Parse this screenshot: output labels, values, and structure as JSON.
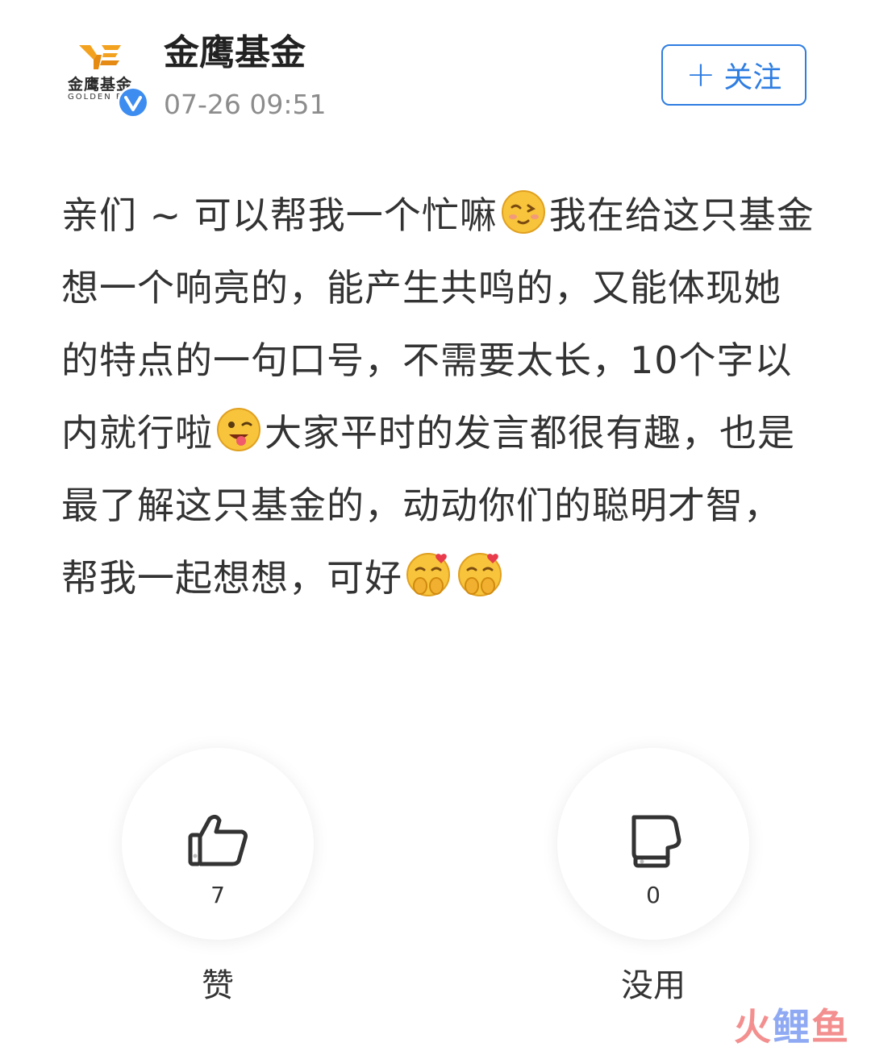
{
  "author": {
    "name": "金鹰基金",
    "time": "07-26 09:51",
    "avatar_logo_cn": "金鹰基金",
    "avatar_logo_en": "GOLDEN EAGLE",
    "verified_icon": "verified-check-icon"
  },
  "follow_button": {
    "plus": "+",
    "label": "关注"
  },
  "post": {
    "segments": [
      {
        "text": "亲们 ~ 可以帮我一个忙嘛"
      },
      {
        "emoji": "smirk-face-emoji"
      },
      {
        "text": "我在给这只基金想一个响亮的，能产生共鸣的，又能体现她的特点的一句口号，不需要太长，10个字以内就行啦"
      },
      {
        "emoji": "wink-tongue-emoji"
      },
      {
        "text": "大家平时的发言都很有趣，也是最了解这只基金的，动动你们的聪明才智，帮我一起想想，可好"
      },
      {
        "emoji": "shy-heart-emoji"
      },
      {
        "emoji": "shy-heart-emoji"
      }
    ]
  },
  "reactions": {
    "like": {
      "icon": "thumbs-up-icon",
      "count": "7",
      "label": "赞"
    },
    "useless": {
      "icon": "thumbs-down-icon",
      "count": "0",
      "label": "没用"
    }
  },
  "watermark": {
    "part1": "火",
    "part2": "鲤",
    "part3": "鱼"
  },
  "colors": {
    "accent": "#2e7de1",
    "text": "#333333",
    "muted": "#8c8c8c"
  }
}
